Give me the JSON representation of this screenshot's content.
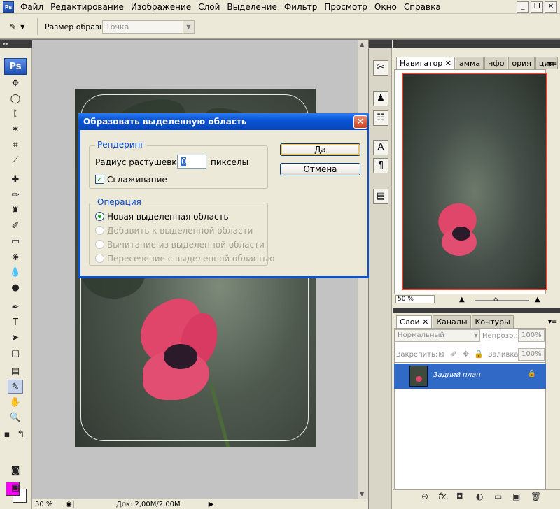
{
  "menubar": {
    "app_icon": "Ps",
    "items": [
      "Файл",
      "Редактирование",
      "Изображение",
      "Слой",
      "Выделение",
      "Фильтр",
      "Просмотр",
      "Окно",
      "Справка"
    ]
  },
  "options_bar": {
    "sample_size_label": "Размер образца:",
    "sample_size_value": "Точка"
  },
  "toolbox": {
    "logo": "Ps",
    "foreground_color": "#ff00ff",
    "background_color": "#ffffff"
  },
  "statusbar": {
    "zoom": "50 %",
    "doc_info": "Док: 2,00M/2,00M"
  },
  "dialog": {
    "title": "Образовать выделенную область",
    "rendering_group": "Рендеринг",
    "feather_label": "Радиус растушевки:",
    "feather_value": "0",
    "feather_unit": "пикселы",
    "antialias_label": "Сглаживание",
    "antialias_checked": true,
    "operation_group": "Операция",
    "operations": [
      {
        "label": "Новая выделенная область",
        "selected": true,
        "enabled": true
      },
      {
        "label": "Добавить к выделенной области",
        "selected": false,
        "enabled": false
      },
      {
        "label": "Вычитание из выделенной области",
        "selected": false,
        "enabled": false
      },
      {
        "label": "Пересечение с выделенной областью",
        "selected": false,
        "enabled": false
      }
    ],
    "ok_label": "Да",
    "cancel_label": "Отмена"
  },
  "navigator": {
    "tabs": [
      "Навигатор",
      "амма",
      "нфо",
      "ория",
      "ции"
    ],
    "zoom": "50 %"
  },
  "layers": {
    "tabs": [
      "Слои",
      "Каналы",
      "Контуры"
    ],
    "blend_mode": "Нормальный",
    "opacity_label": "Непрозр.:",
    "opacity_value": "100%",
    "lock_label": "Закрепить:",
    "fill_label": "Заливка:",
    "fill_value": "100%",
    "layer_name": "Задний план"
  },
  "colors": {
    "accent": "#0a53d4",
    "selected_layer": "#3169c6",
    "navigator_frame": "#e04a3c"
  }
}
